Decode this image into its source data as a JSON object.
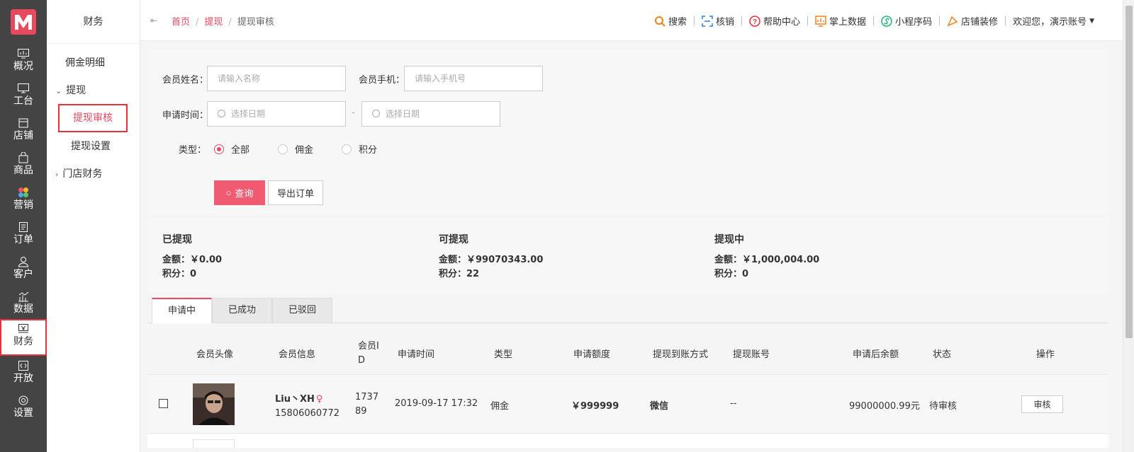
{
  "rail": {
    "items": [
      {
        "label": "概况",
        "icon": "monitor-chart-icon"
      },
      {
        "label": "工台",
        "icon": "desktop-icon"
      },
      {
        "label": "店铺",
        "icon": "store-icon"
      },
      {
        "label": "商品",
        "icon": "bag-icon"
      },
      {
        "label": "营销",
        "icon": "marketing-dots-icon"
      },
      {
        "label": "订单",
        "icon": "order-icon"
      },
      {
        "label": "客户",
        "icon": "user-icon"
      },
      {
        "label": "数据",
        "icon": "data-chart-icon"
      },
      {
        "label": "财务",
        "icon": "yen-register-icon"
      },
      {
        "label": "开放",
        "icon": "code-icon"
      },
      {
        "label": "设置",
        "icon": "gear-icon"
      }
    ],
    "active": "财务"
  },
  "subnav": {
    "title": "财务",
    "items": [
      "佣金明细",
      "提现",
      "提现审核",
      "提现设置",
      "门店财务"
    ]
  },
  "topbar": {
    "breadcrumb": [
      "首页",
      "提现",
      "提现审核"
    ],
    "links": [
      {
        "label": "搜索",
        "icon": "search-icon"
      },
      {
        "label": "核销",
        "icon": "scan-icon"
      },
      {
        "label": "帮助中心",
        "icon": "help-icon"
      },
      {
        "label": "掌上数据",
        "icon": "bar-chart-icon"
      },
      {
        "label": "小程序码",
        "icon": "mini-program-icon"
      },
      {
        "label": "店铺装修",
        "icon": "paint-icon"
      }
    ],
    "welcome": "欢迎您，演示账号"
  },
  "filters": {
    "member_name_label": "会员姓名：",
    "member_name_placeholder": "请输入名称",
    "member_phone_label": "会员手机：",
    "member_phone_placeholder": "请输入手机号",
    "apply_time_label": "申请时间：",
    "date_placeholder": "选择日期",
    "date_separator": "-",
    "type_label": "类型：",
    "type_options": [
      "全部",
      "佣金",
      "积分"
    ],
    "type_selected": "全部",
    "query_button": "查询",
    "export_button": "导出订单"
  },
  "stats": [
    {
      "title": "已提现",
      "amount": "金额：￥0.00",
      "points": "积分：0"
    },
    {
      "title": "可提现",
      "amount": "金额：￥99070343.00",
      "points": "积分：22"
    },
    {
      "title": "提现中",
      "amount": "金额：￥1,000,004.00",
      "points": "积分：0"
    }
  ],
  "tabs": [
    "申请中",
    "已成功",
    "已驳回"
  ],
  "active_tab": "申请中",
  "table": {
    "headers": [
      "会员头像",
      "会员信息",
      "会员ID",
      "申请时间",
      "类型",
      "申请额度",
      "提现到账方式",
      "提现账号",
      "申请后余额",
      "状态",
      "操作"
    ],
    "rows": [
      {
        "member_name": "Liu丶XH",
        "gender_symbol": "♀",
        "phone": "15806060772",
        "member_id": "173789",
        "apply_time": "2019-09-17 17:32",
        "type": "佣金",
        "amount": "￥999999",
        "method": "微信",
        "account": "--",
        "balance_after": "99000000.99元",
        "status": "待审核",
        "action": "审核"
      }
    ]
  }
}
